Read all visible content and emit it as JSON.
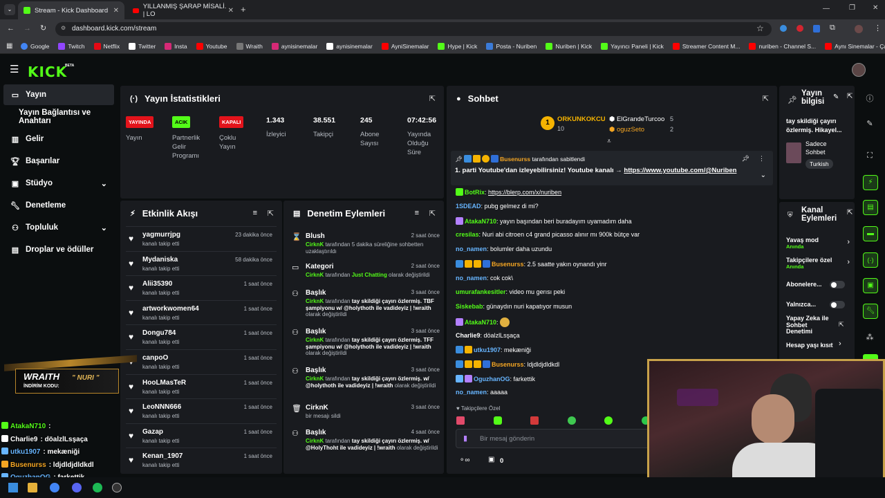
{
  "browser": {
    "tabs": [
      {
        "label": "Stream - Kick Dashboard"
      },
      {
        "label": "YILLANMIŞ ŞARAP MİSALİ. | LO"
      }
    ],
    "url": "dashboard.kick.com/stream",
    "bookmarks": [
      "Google",
      "Twitch",
      "Netflix",
      "Twitter",
      "Insta",
      "Youtube",
      "Wraith",
      "aynisinemalar",
      "aynisinemalar",
      "AyniSinemalar",
      "Hype | Kick",
      "Posta - Nuriben",
      "Nuriben | Kick",
      "Yayıncı Paneli | Kick",
      "Streamer Content M...",
      "nuriben - Channel S...",
      "Aynı Sinemalar - Ça..."
    ]
  },
  "brand": {
    "logo": "KICK",
    "beta": "BETA",
    "accent": "#53fc18"
  },
  "sidebar": {
    "items": [
      {
        "label": "Yayın",
        "icon": "video-icon"
      },
      {
        "label": "Yayın Bağlantısı ve Anahtarı",
        "icon": ""
      },
      {
        "label": "Gelir",
        "icon": "chart-icon"
      },
      {
        "label": "Başarılar",
        "icon": "trophy-icon"
      },
      {
        "label": "Stüdyo",
        "icon": "studio-icon"
      },
      {
        "label": "Denetleme",
        "icon": "wrench-icon"
      },
      {
        "label": "Topluluk",
        "icon": "community-icon"
      },
      {
        "label": "Droplar ve ödüller",
        "icon": "gift-icon"
      }
    ]
  },
  "stats": {
    "title": "Yayın İstatistikleri",
    "items": [
      {
        "badge": "YAYINDA",
        "badge_color": "#e3131b",
        "label": "Yayın"
      },
      {
        "badge": "ACIK",
        "badge_color": "#53fc18",
        "label": "Partnerlik Gelir Programı"
      },
      {
        "badge": "KAPALI",
        "badge_color": "#e3131b",
        "label": "Çoklu Yayın"
      },
      {
        "value": "1.343",
        "label": "İzleyici"
      },
      {
        "value": "38.551",
        "label": "Takipçi"
      },
      {
        "value": "245",
        "label": "Abone Sayısı"
      },
      {
        "value": "07:42:56",
        "label": "Yayında Olduğu Süre"
      }
    ]
  },
  "activity": {
    "title": "Etkinlik Akışı",
    "rows": [
      {
        "name": "yagmurrjpg",
        "sub": "kanalı takip etti",
        "time": "23 dakika önce"
      },
      {
        "name": "Mydaniska",
        "sub": "kanalı takip etti",
        "time": "58 dakika önce"
      },
      {
        "name": "Alii35390",
        "sub": "kanalı takip etti",
        "time": "1 saat önce"
      },
      {
        "name": "artworkwomen64",
        "sub": "kanalı takip etti",
        "time": "1 saat önce"
      },
      {
        "name": "Dongu784",
        "sub": "kanalı takip etti",
        "time": "1 saat önce"
      },
      {
        "name": "canpoO",
        "sub": "kanalı takip etti",
        "time": "1 saat önce"
      },
      {
        "name": "HooLMasTeR",
        "sub": "kanalı takip etti",
        "time": "1 saat önce"
      },
      {
        "name": "LeoNNN666",
        "sub": "kanalı takip etti",
        "time": "1 saat önce"
      },
      {
        "name": "Gazap",
        "sub": "kanalı takip etti",
        "time": "1 saat önce"
      },
      {
        "name": "Kenan_1907",
        "sub": "kanalı takip etti",
        "time": "1 saat önce"
      }
    ]
  },
  "moderation": {
    "title": "Denetim Eylemleri",
    "rows": [
      {
        "name": "Blush",
        "time": "2 saat önce",
        "actor": "CirknK",
        "desc": " tarafından 5 dakika süreliğine sohbetten uzaklaştırıldı",
        "hl": ""
      },
      {
        "name": "Kategori",
        "time": "2 saat önce",
        "actor": "CirknK",
        "desc": " tarafından ",
        "hl": "Just Chatting",
        "desc2": " olarak değiştirildi"
      },
      {
        "name": "Başlık",
        "time": "3 saat önce",
        "actor": "CirknK",
        "desc": " tarafından ",
        "bold": "tay skildiği çayırı özlermiş. TBF şampiyonu w/ @holythoth ile vadideyiz | !wraith",
        "desc2": " olarak değiştirildi"
      },
      {
        "name": "Başlık",
        "time": "3 saat önce",
        "actor": "CirknK",
        "desc": " tarafından ",
        "bold": "tay skildiği çayırı özlermiş. TFF şampiyonu w/ @holythoth ile vadideyiz | !wraith",
        "desc2": " olarak değiştirildi"
      },
      {
        "name": "Başlık",
        "time": "3 saat önce",
        "actor": "CirknK",
        "desc": " tarafından ",
        "bold": "tay skildiği çayırı özlermiş. w/ @holythoth ile vadideyiz | !wraith",
        "desc2": " olarak değiştirildi"
      },
      {
        "name": "CirknK",
        "time": "3 saat önce",
        "plain": "bir mesajı sildi"
      },
      {
        "name": "Başlık",
        "time": "4 saat önce",
        "actor": "CirknK",
        "desc": " tarafından ",
        "bold": "tay skildiği çayırı özlermiş. w/ @HolyThoht ile vadideyiz | !wraith",
        "desc2": " olarak değiştirildi"
      }
    ]
  },
  "chat": {
    "title": "Sohbet",
    "leaders": [
      {
        "name": "ORKUNKOKCU",
        "count": "10"
      },
      {
        "name": "ElGrandeTurcoo",
        "count": "5"
      },
      {
        "name": "oguzSeto",
        "count": "2"
      }
    ],
    "pinned_by": "Busenurss",
    "pinned_suffix": " tarafından sabitlendi",
    "pinned_text": "1. parti Youtube'dan izleyebilirsiniz! Youtube kanalı → ",
    "pinned_link": "https://www.youtube.com/@Nuriben",
    "messages": [
      {
        "user": "BotRix",
        "color": "#53fc18",
        "text": "https://blerp.com/x/nuriben",
        "link": true
      },
      {
        "user": "1SDEAD",
        "color": "#67b5ff",
        "text": "pubg gelmez di mi?"
      },
      {
        "user": "AtakaN710",
        "color": "#53fc18",
        "text": "yayın başından beri buradayım uyamadım daha"
      },
      {
        "user": "cresilas",
        "color": "#53fc18",
        "text": "Nuri abi citroen c4 grand picasso alınır mı 900k bütçe var"
      },
      {
        "user": "no_namen",
        "color": "#67b5ff",
        "text": "bolumler daha uzundu"
      },
      {
        "user": "Busenurss",
        "color": "#f5a623",
        "text": "2.5 saatte yakın oynandı yinr"
      },
      {
        "user": "no_namen",
        "color": "#67b5ff",
        "text": "cok cok\\"
      },
      {
        "user": "umurafankesitler",
        "color": "#53fc18",
        "text": "video mu gerısı peki"
      },
      {
        "user": "Siskebab",
        "color": "#53fc18",
        "text": "günaydın nuri kapatıyor musun"
      },
      {
        "user": "AtakaN710",
        "color": "#53fc18",
        "text": ""
      },
      {
        "user": "Charlie9",
        "color": "#fff",
        "text": "döalzlLsşaça"
      },
      {
        "user": "utku1907",
        "color": "#67b5ff",
        "text": "mekæniği"
      },
      {
        "user": "Busenurss",
        "color": "#f5a623",
        "text": "ldjdldjdldkdl"
      },
      {
        "user": "OguzhanOG",
        "color": "#67b5ff",
        "text": "farkettik"
      },
      {
        "user": "no_namen",
        "color": "#67b5ff",
        "text": "aaaaa"
      }
    ],
    "followers_only": "Takipçilere Özel",
    "input_placeholder": "Bir mesaj gönderin",
    "points": "0"
  },
  "stream_info": {
    "title": "Yayın bilgisi",
    "stream_title": "tay skildiği çayırı özlermiş. Hikayel...",
    "category": "Sadece Sohbet",
    "language": "Turkish"
  },
  "channel_actions": {
    "title": "Kanal Eylemleri",
    "items": [
      {
        "label": "Yavaş mod",
        "sub": "Anında"
      },
      {
        "label": "Takipçilere özel",
        "sub": "Anında"
      },
      {
        "label": "Abonelere...",
        "toggle": true
      },
      {
        "label": "Yalnızca...",
        "toggle": true
      },
      {
        "label": "Yapay Zeka ile Sohbet Denetimi"
      },
      {
        "label": "Hesap yaşı kısıt"
      }
    ]
  },
  "overlay": {
    "promo_name": "WRAITH",
    "promo_tag": "\" NURI \"",
    "promo_code": "İNDİRİM KODU:",
    "chat": [
      {
        "user": "AtakaN710",
        "color": "#53fc18",
        "text": ":"
      },
      {
        "user": "Charlie9",
        "color": "#fff",
        "text": ": döalzlLsşaça"
      },
      {
        "user": "utku1907",
        "color": "#67b5ff",
        "text": ": mekæniği"
      },
      {
        "user": "Busenurss",
        "color": "#f5a623",
        "text": ": ldjdldjdldkdl"
      },
      {
        "user": "OguzhanOG",
        "color": "#67b5ff",
        "text": ": farkettik"
      },
      {
        "user": "no_namen",
        "color": "#fff",
        "text": ": aaaaa"
      }
    ]
  }
}
